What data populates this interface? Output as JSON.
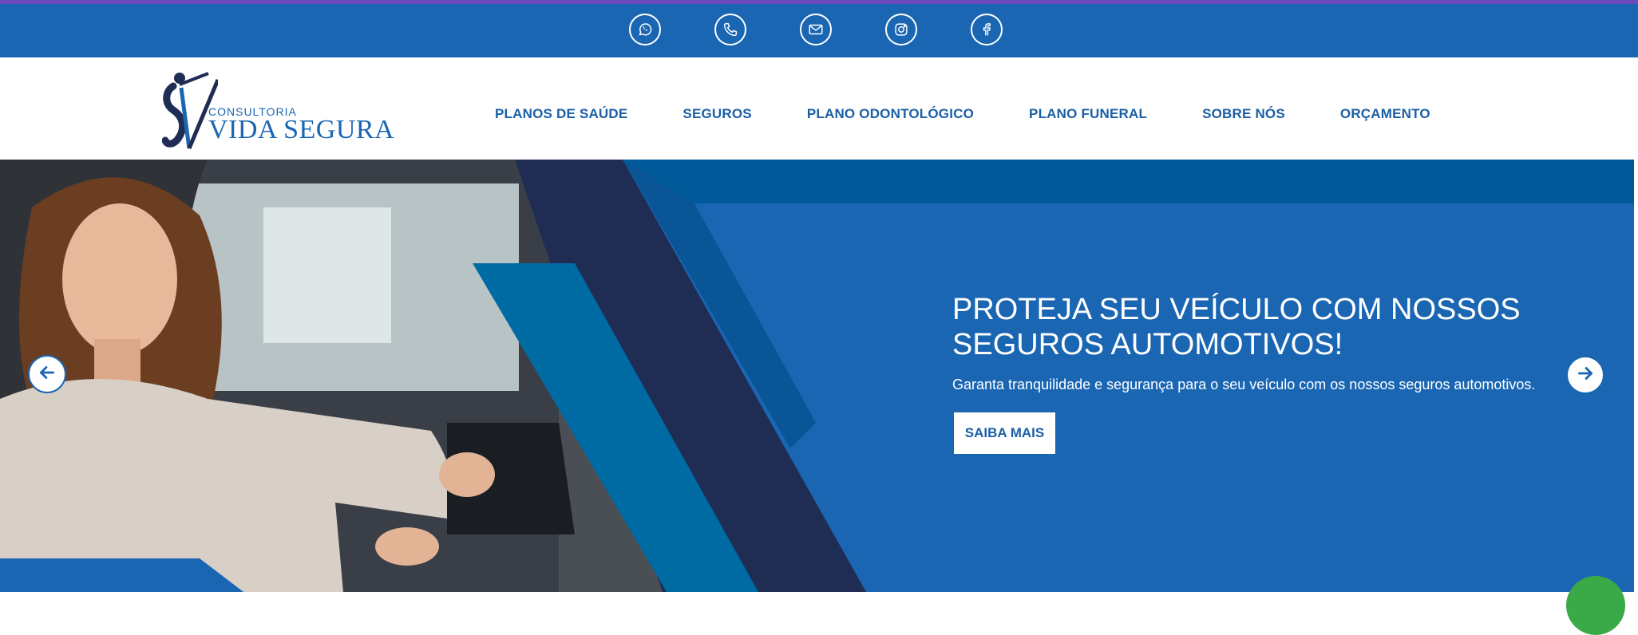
{
  "social": [
    {
      "icon": "whatsapp-icon"
    },
    {
      "icon": "phone-icon"
    },
    {
      "icon": "mail-icon"
    },
    {
      "icon": "instagram-icon"
    },
    {
      "icon": "facebook-icon"
    }
  ],
  "logo": {
    "small": "CONSULTORIA",
    "big": "VIDA SEGURA"
  },
  "nav": [
    {
      "label": "PLANOS DE SAÚDE"
    },
    {
      "label": "SEGUROS"
    },
    {
      "label": "PLANO ODONTOLÓGICO"
    },
    {
      "label": "PLANO FUNERAL"
    },
    {
      "label": "SOBRE NÓS"
    },
    {
      "label": "ORÇAMENTO"
    }
  ],
  "hero": {
    "title": "PROTEJA SEU VEÍCULO COM NOSSOS SEGUROS AUTOMOTIVOS!",
    "subtitle": "Garanta tranquilidade e segurança para o seu veículo com os nossos seguros automotivos.",
    "cta": "SAIBA MAIS",
    "prev_icon": "arrow-left-icon",
    "next_icon": "arrow-right-icon"
  },
  "colors": {
    "brand_blue": "#1a66b3",
    "dark_navy": "#1f2d55",
    "teal": "#006aa3",
    "top_border": "#6f49bf",
    "chat_green": "#3aaa48"
  }
}
